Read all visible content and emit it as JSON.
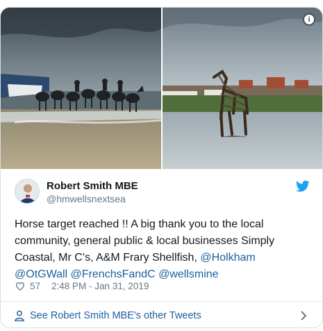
{
  "tweet": {
    "author_name": "Robert Smith MBE",
    "author_handle": "@hmwellsnextsea",
    "text_plain_1": "Horse target reached !! A big thank you to the local community, general public & local businesses Simply Coastal, Mr C’s, A&M Frary Shellfish, ",
    "links": [
      "@Holkham",
      "@OtGWall",
      "@FrenchsFandC",
      "@wellsmine"
    ],
    "likes": "57",
    "timestamp": "2:48 PM - Jan 31, 2019",
    "footer_link": "See Robert Smith MBE's other Tweets"
  },
  "icons": {
    "info": "info-icon",
    "brand": "twitter-bird-icon",
    "like": "heart-icon",
    "footer": "person-icon",
    "chevron": "chevron-right-icon"
  },
  "colors": {
    "link": "#1b5f9e",
    "brand_blue": "#1da1f2",
    "muted": "#657786",
    "text": "#14171a"
  }
}
